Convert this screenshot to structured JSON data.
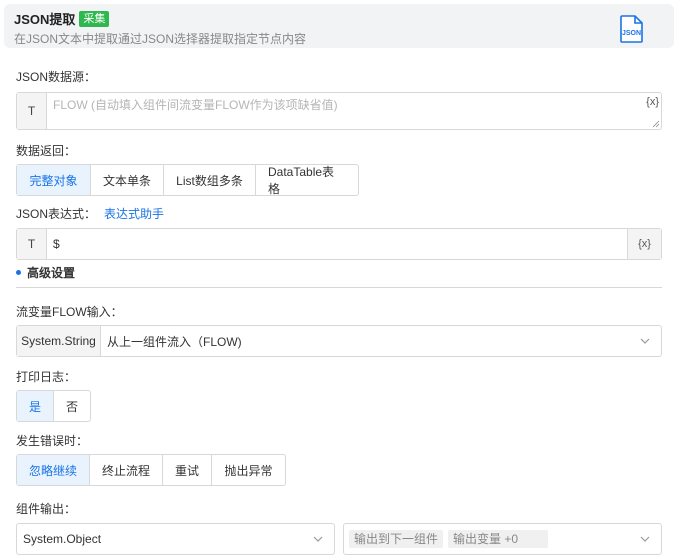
{
  "header": {
    "title": "JSON提取",
    "badge": "采集",
    "description": "在JSON文本中提取通过JSON选择器提取指定节点内容",
    "icon_text": "JSON",
    "accent": "#1a73e8",
    "badge_color": "#2fb84f"
  },
  "json_source": {
    "label": "JSON数据源：",
    "prefix": "T",
    "placeholder": "FLOW (自动填入组件间流变量FLOW作为该项缺省值)",
    "var_button": "{x}"
  },
  "data_return": {
    "label": "数据返回：",
    "options": [
      "完整对象",
      "文本单条",
      "List数组多条",
      "DataTable表格"
    ],
    "selected": "完整对象"
  },
  "json_expression": {
    "label": "JSON表达式：",
    "helper_link": "表达式助手",
    "prefix": "T",
    "value": "$",
    "var_button": "{x}"
  },
  "advanced": {
    "title": "高级设置"
  },
  "flow_input": {
    "label": "流变量FLOW输入：",
    "type": "System.String",
    "value": "从上一组件流入（FLOW)"
  },
  "print_log": {
    "label": "打印日志：",
    "options": [
      "是",
      "否"
    ],
    "selected": "是"
  },
  "on_error": {
    "label": "发生错误时：",
    "options": [
      "忽略继续",
      "终止流程",
      "重试",
      "抛出异常"
    ],
    "selected": "忽略继续"
  },
  "component_output": {
    "label": "组件输出：",
    "type_value": "System.Object",
    "tags": [
      "输出到下一组件",
      "输出变量 +0"
    ]
  }
}
